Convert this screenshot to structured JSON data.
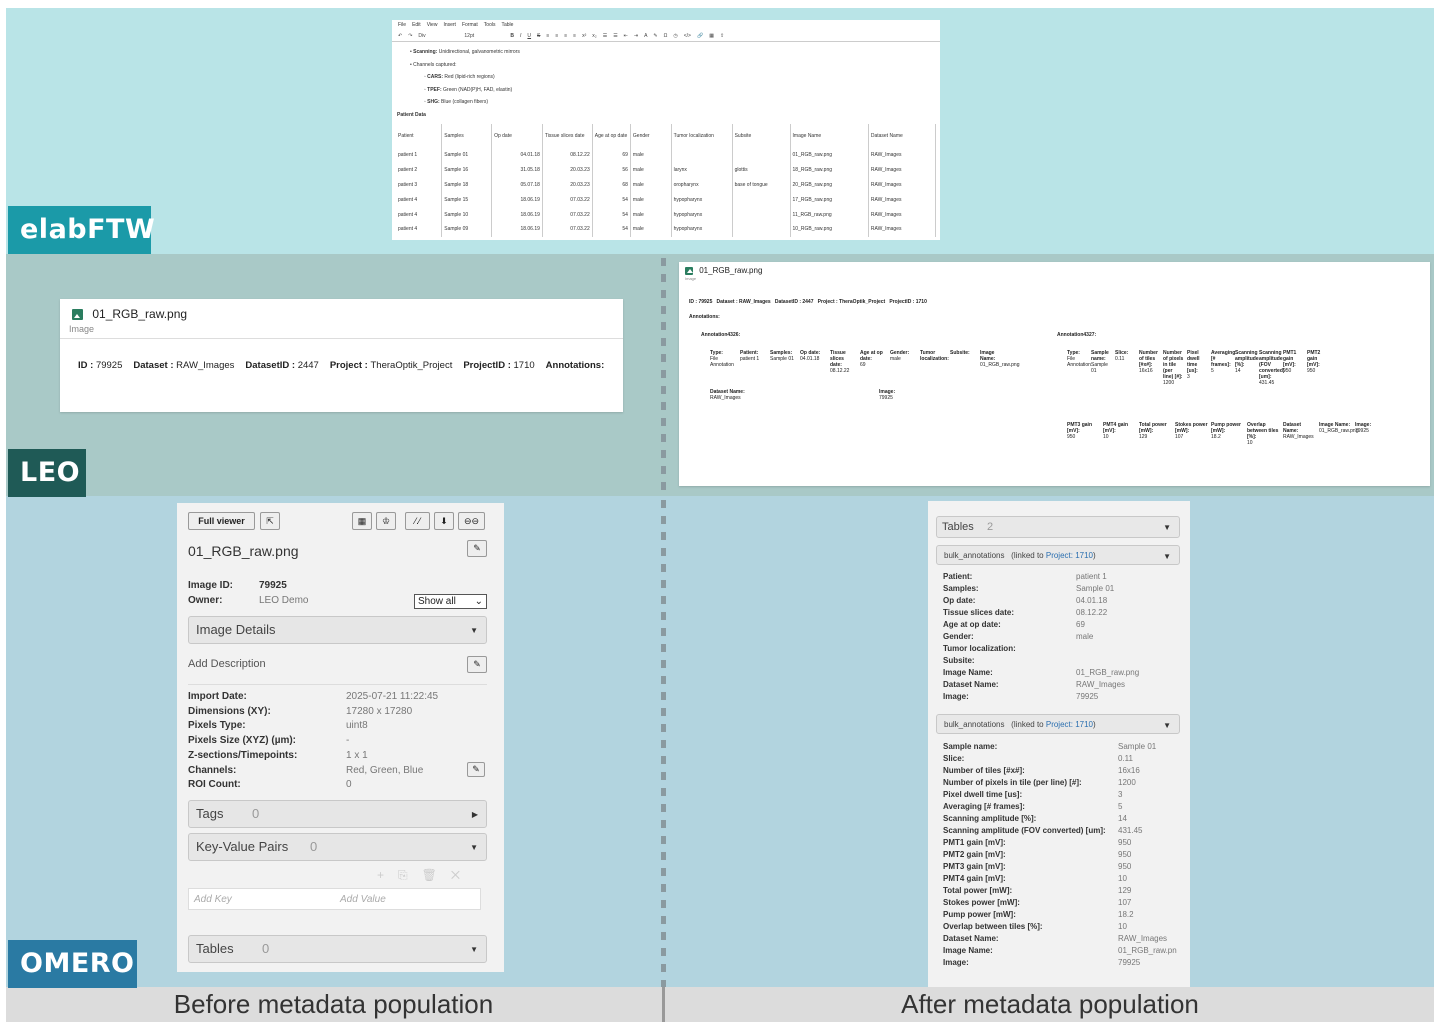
{
  "bands": {
    "elab_label": "elabFTW",
    "leo_label": "LEO",
    "omero_label": "OMERO",
    "caption_before": "Before metadata population",
    "caption_after": "After metadata population",
    "colors": {
      "elab": "#b9e4e7",
      "leo": "#a9c9c7",
      "omero": "#b2d4df",
      "tag_elab": "#1b9aa8",
      "tag_leo": "#1f5a56",
      "tag_omero": "#2a7aa3"
    }
  },
  "elab": {
    "menu": [
      "File",
      "Edit",
      "View",
      "Insert",
      "Format",
      "Tools",
      "Table"
    ],
    "toolbar_font": "Div",
    "toolbar_size": "12pt",
    "bullets": [
      {
        "bold": "Scanning:",
        "text": " Unidirectional, galvanometric mirrors",
        "level": 1
      },
      {
        "bold": "",
        "text": "Channels captured:",
        "level": 1
      },
      {
        "bold": "CARS:",
        "text": " Red (lipid-rich regions)",
        "level": 2
      },
      {
        "bold": "TPEF:",
        "text": " Green (NAD(P)H, FAD, elastin)",
        "level": 2
      },
      {
        "bold": "SHG:",
        "text": " Blue (collagen fibers)",
        "level": 2
      }
    ],
    "patient_heading": "Patient Data",
    "columns": [
      "Patient",
      "Samples",
      "Op date",
      "Tissue slices date",
      "Age at op date",
      "Gender",
      "Tumor localization",
      "Subsite",
      "Image Name",
      "Dataset Name"
    ],
    "rows": [
      [
        "patient 1",
        "Sample 01",
        "04.01.18",
        "08.12.22",
        "69",
        "male",
        "",
        "",
        "01_RGB_raw.png",
        "RAW_Images"
      ],
      [
        "patient 2",
        "Sample 16",
        "31.05.18",
        "20.03.23",
        "56",
        "male",
        "larynx",
        "glottis",
        "18_RGB_raw.png",
        "RAW_Images"
      ],
      [
        "patient 3",
        "Sample 18",
        "05.07.18",
        "20.03.23",
        "68",
        "male",
        "oropharynx",
        "base of tongue",
        "20_RGB_raw.png",
        "RAW_Images"
      ],
      [
        "patient 4",
        "Sample 15",
        "18.06.19",
        "07.03.22",
        "54",
        "male",
        "hypopharynx",
        "",
        "17_RGB_raw.png",
        "RAW_Images"
      ],
      [
        "patient 4",
        "Sample 10",
        "18.06.19",
        "07.03.22",
        "54",
        "male",
        "hypopharynx",
        "",
        "11_RGB_raw.png",
        "RAW_Images"
      ],
      [
        "patient 4",
        "Sample 09",
        "18.06.19",
        "07.03.22",
        "54",
        "male",
        "hypopharynx",
        "",
        "10_RGB_raw.png",
        "RAW_Images"
      ]
    ]
  },
  "leo_before": {
    "filename": "01_RGB_raw.png",
    "type": "Image",
    "meta": [
      {
        "k": "ID",
        "v": "79925"
      },
      {
        "k": "Dataset",
        "v": "RAW_Images"
      },
      {
        "k": "DatasetID",
        "v": "2447"
      },
      {
        "k": "Project",
        "v": "TheraOptik_Project"
      },
      {
        "k": "ProjectID",
        "v": "1710"
      }
    ],
    "annotations_label": "Annotations:"
  },
  "leo_after": {
    "filename": "01_RGB_raw.png",
    "type": "Image",
    "meta_line": "ID : 79925   Dataset : RAW_Images   DatasetID : 2447   Project : TheraOptik_Project   ProjectID : 1710",
    "annotations_label": "Annotations:",
    "ann1_title": "Annotation4326:",
    "ann1": [
      {
        "k": "Type:",
        "v": "File Annotation"
      },
      {
        "k": "Patient:",
        "v": "patient 1"
      },
      {
        "k": "Samples:",
        "v": "Sample 01"
      },
      {
        "k": "Op date:",
        "v": "04.01.18"
      },
      {
        "k": "Tissue slices date:",
        "v": "08.12.22"
      },
      {
        "k": "Age at op date:",
        "v": "69"
      },
      {
        "k": "Gender:",
        "v": "male"
      },
      {
        "k": "Tumor localization:",
        "v": ""
      },
      {
        "k": "Subsite:",
        "v": ""
      },
      {
        "k": "Image Name:",
        "v": "01_RGB_raw.png"
      }
    ],
    "ann1_b": [
      {
        "k": "Dataset Name:",
        "v": "RAW_Images"
      },
      {
        "k": "Image:",
        "v": "79925"
      }
    ],
    "ann2_title": "Annotation4327:",
    "ann2": [
      {
        "k": "Type:",
        "v": "File Annotation"
      },
      {
        "k": "Sample name:",
        "v": "Sample 01"
      },
      {
        "k": "Slice:",
        "v": "0.11"
      },
      {
        "k": "Number of tiles [#x#]:",
        "v": "16x16"
      },
      {
        "k": "Number of pixels in tile (per line) [#]:",
        "v": "1200"
      },
      {
        "k": "Pixel dwell time [us]:",
        "v": "3"
      },
      {
        "k": "Averaging [# frames]:",
        "v": "5"
      },
      {
        "k": "Scanning amplitude [%]:",
        "v": "14"
      },
      {
        "k": "Scanning amplitude (FOV converted) [um]:",
        "v": "431.45"
      },
      {
        "k": "PMT1 gain [mV]:",
        "v": "950"
      },
      {
        "k": "PMT2 gain [mV]:",
        "v": "950"
      }
    ],
    "ann2_b": [
      {
        "k": "PMT3 gain [mV]:",
        "v": "950"
      },
      {
        "k": "PMT4 gain [mV]:",
        "v": "10"
      },
      {
        "k": "Total power [mW]:",
        "v": "129"
      },
      {
        "k": "Stokes power [mW]:",
        "v": "107"
      },
      {
        "k": "Pump power [mW]:",
        "v": "18.2"
      },
      {
        "k": "Overlap between tiles [%]:",
        "v": "10"
      },
      {
        "k": "Dataset Name:",
        "v": "RAW_Images"
      },
      {
        "k": "Image Name:",
        "v": "01_RGB_raw.png"
      },
      {
        "k": "Image:",
        "v": "79925"
      }
    ]
  },
  "omero_before": {
    "full_viewer": "Full viewer",
    "filename": "01_RGB_raw.png",
    "image_id_label": "Image ID:",
    "image_id": "79925",
    "owner_label": "Owner:",
    "owner": "LEO Demo",
    "show_all": "Show all",
    "image_details": "Image Details",
    "add_description": "Add Description",
    "details": [
      {
        "k": "Import Date:",
        "v": "2025-07-21 11:22:45"
      },
      {
        "k": "Dimensions (XY):",
        "v": "17280 x 17280"
      },
      {
        "k": "Pixels Type:",
        "v": "uint8"
      },
      {
        "k": "Pixels Size (XYZ) (µm):",
        "v": "-"
      },
      {
        "k": "Z-sections/Timepoints:",
        "v": "1 x 1"
      },
      {
        "k": "Channels:",
        "v": "Red, Green, Blue"
      },
      {
        "k": "ROI Count:",
        "v": "0"
      }
    ],
    "tags": "Tags",
    "tags_count": "0",
    "kv_pairs": "Key-Value Pairs",
    "kv_count": "0",
    "add_key": "Add Key",
    "add_value": "Add Value",
    "tables": "Tables",
    "tables_count": "0"
  },
  "omero_after": {
    "tables": "Tables",
    "tables_count": "2",
    "bulk1": "bulk_annotations",
    "bulk1_linked": "(linked to ",
    "bulk1_project": "Project: 1710",
    "bulk1_close": ")",
    "list1": [
      {
        "k": "Patient:",
        "v": "patient 1"
      },
      {
        "k": "Samples:",
        "v": "Sample 01"
      },
      {
        "k": "Op date:",
        "v": "04.01.18"
      },
      {
        "k": "Tissue slices date:",
        "v": "08.12.22"
      },
      {
        "k": "Age at op date:",
        "v": "69"
      },
      {
        "k": "Gender:",
        "v": "male"
      },
      {
        "k": "Tumor localization:",
        "v": ""
      },
      {
        "k": "Subsite:",
        "v": ""
      },
      {
        "k": "Image Name:",
        "v": "01_RGB_raw.png"
      },
      {
        "k": "Dataset Name:",
        "v": "RAW_Images"
      },
      {
        "k": "Image:",
        "v": "79925"
      }
    ],
    "bulk2": "bulk_annotations",
    "bulk2_linked": "(linked to ",
    "bulk2_project": "Project: 1710",
    "bulk2_close": ")",
    "list2": [
      {
        "k": "Sample name:",
        "v": "Sample 01"
      },
      {
        "k": "Slice:",
        "v": "0.11"
      },
      {
        "k": "Number of tiles [#x#]:",
        "v": "16x16"
      },
      {
        "k": "Number of pixels in tile (per line) [#]:",
        "v": "1200"
      },
      {
        "k": "Pixel dwell time [us]:",
        "v": "3"
      },
      {
        "k": "Averaging [# frames]:",
        "v": "5"
      },
      {
        "k": "Scanning amplitude [%]:",
        "v": "14"
      },
      {
        "k": "Scanning amplitude (FOV converted) [um]:",
        "v": "431.45"
      },
      {
        "k": "PMT1 gain [mV]:",
        "v": "950"
      },
      {
        "k": "PMT2 gain [mV]:",
        "v": "950"
      },
      {
        "k": "PMT3 gain [mV]:",
        "v": "950"
      },
      {
        "k": "PMT4 gain [mV]:",
        "v": "10"
      },
      {
        "k": "Total power [mW]:",
        "v": "129"
      },
      {
        "k": "Stokes power [mW]:",
        "v": "107"
      },
      {
        "k": "Pump power [mW]:",
        "v": "18.2"
      },
      {
        "k": "Overlap between tiles [%]:",
        "v": "10"
      },
      {
        "k": "Dataset Name:",
        "v": "RAW_Images"
      },
      {
        "k": "Image Name:",
        "v": "01_RGB_raw.pn"
      },
      {
        "k": "Image:",
        "v": "79925"
      }
    ]
  }
}
